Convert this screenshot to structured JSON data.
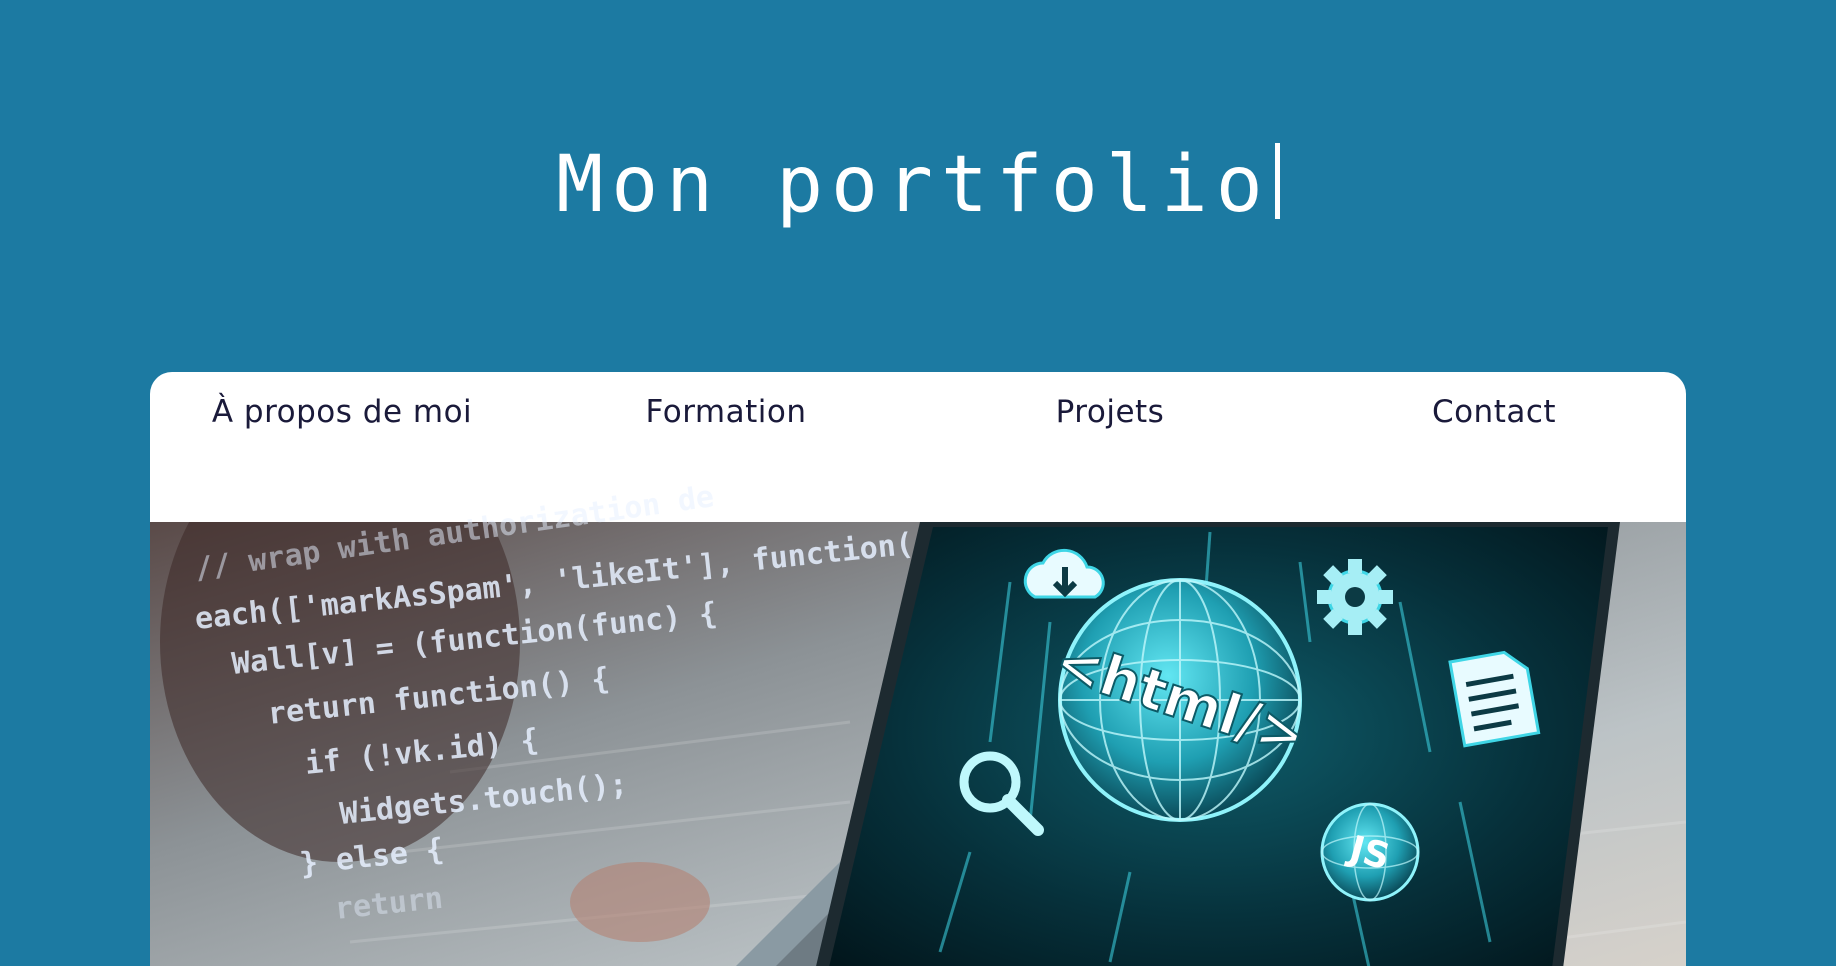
{
  "header": {
    "title": "Mon portfolio"
  },
  "nav": {
    "items": [
      {
        "label": "À propos de moi"
      },
      {
        "label": "Formation"
      },
      {
        "label": "Projets"
      },
      {
        "label": "Contact"
      }
    ]
  },
  "hero_image": {
    "code_lines": [
      "// wrap with authorization de",
      "each(['markAsSpam', 'likeIt'], function(",
      "Wall[v] = (function(func) {",
      "return function() {",
      "if (!vk.id) {",
      "Widgets.touch();",
      "} else {",
      "return"
    ],
    "screen_label": "<html/>",
    "js_badge": "JS"
  },
  "colors": {
    "background": "#1c7aa2",
    "card": "#ffffff",
    "nav_text": "#1a1a3a",
    "screen_glow": "#3fd6e6"
  },
  "icons": [
    "cloud-download-icon",
    "gear-icon",
    "document-icon",
    "search-icon",
    "globe-icon"
  ]
}
